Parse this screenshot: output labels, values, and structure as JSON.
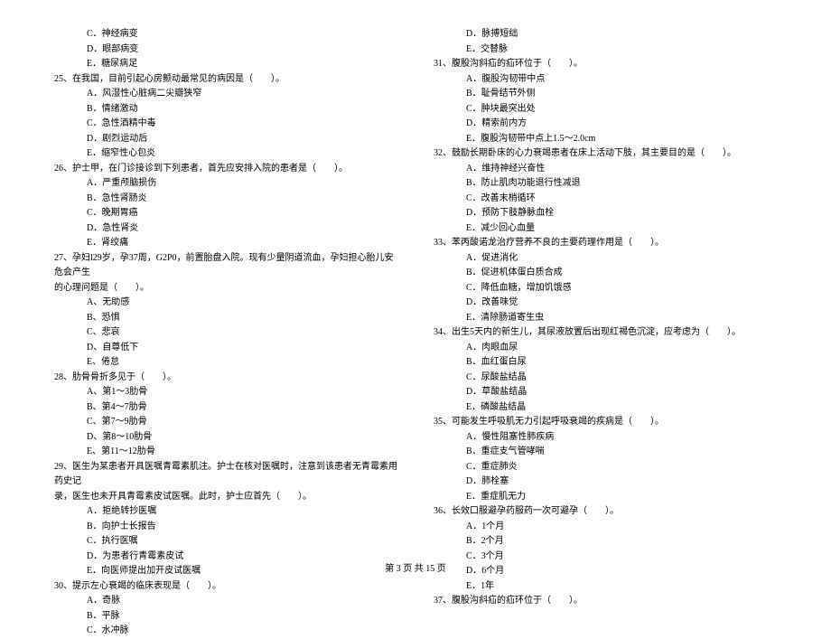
{
  "leftColumn": {
    "lines": [
      {
        "type": "option",
        "text": "C．神经病变"
      },
      {
        "type": "option",
        "text": "D．眼部病变"
      },
      {
        "type": "option",
        "text": "E．糖尿病足"
      },
      {
        "type": "question",
        "text": "25、在我国，目前引起心房颤动最常见的病因是（　　）。"
      },
      {
        "type": "option",
        "text": "A．风湿性心脏病二尖瓣狭窄"
      },
      {
        "type": "option",
        "text": "B．情绪激动"
      },
      {
        "type": "option",
        "text": "C．急性酒精中毒"
      },
      {
        "type": "option",
        "text": "D．剧烈运动后"
      },
      {
        "type": "option",
        "text": "E．缩窄性心包炎"
      },
      {
        "type": "question",
        "text": "26、护士甲，在门诊接诊到下列患者，首先应安排入院的患者是（　　）。"
      },
      {
        "type": "option",
        "text": "A．严重颅脑损伤"
      },
      {
        "type": "option",
        "text": "B．急性肾肠炎"
      },
      {
        "type": "option",
        "text": "C．晚期胃癌"
      },
      {
        "type": "option",
        "text": "D．急性肾炎"
      },
      {
        "type": "option",
        "text": "E．肾绞痛"
      },
      {
        "type": "question",
        "text": "27、孕妇l29岁，孕37周，G2P0，前置胎盘入院。现有少量阴道流血，孕妇担心胎儿安危会产生"
      },
      {
        "type": "continue",
        "text": "的心理问题是（　　）。"
      },
      {
        "type": "option",
        "text": "A、无助感"
      },
      {
        "type": "option",
        "text": "B、恐惧"
      },
      {
        "type": "option",
        "text": "C、悲哀"
      },
      {
        "type": "option",
        "text": "D、自尊低下"
      },
      {
        "type": "option",
        "text": "E、倦怠"
      },
      {
        "type": "question",
        "text": "28、肋骨骨折多见于（　　）。"
      },
      {
        "type": "option",
        "text": "A、第1～3肋骨"
      },
      {
        "type": "option",
        "text": "B、第4～7肋骨"
      },
      {
        "type": "option",
        "text": "C、第7～9肋骨"
      },
      {
        "type": "option",
        "text": "D、第8～10肋骨"
      },
      {
        "type": "option",
        "text": "E、第11～12肋骨"
      },
      {
        "type": "question",
        "text": "29、医生为某患者开具医嘱青霉素肌注。护士在核对医嘱时，注意到该患者无青霉素用药史记"
      },
      {
        "type": "continue",
        "text": "录，医生也未开具青霉素皮试医嘱。此时，护士应首先（　　）。"
      },
      {
        "type": "option",
        "text": "A．拒绝转抄医嘱"
      },
      {
        "type": "option",
        "text": "B．向护士长报告"
      },
      {
        "type": "option",
        "text": "C．执行医嘱"
      },
      {
        "type": "option",
        "text": "D．为患者行青霉素皮试"
      },
      {
        "type": "option",
        "text": "E．向医师提出加开皮试医嘱"
      },
      {
        "type": "question",
        "text": "30、提示左心衰竭的临床表现是（　　）。"
      },
      {
        "type": "option",
        "text": "A．奇脉"
      },
      {
        "type": "option",
        "text": "B．平脉"
      },
      {
        "type": "option",
        "text": "C．水冲脉"
      }
    ]
  },
  "rightColumn": {
    "lines": [
      {
        "type": "option",
        "text": "D．脉搏短绌"
      },
      {
        "type": "option",
        "text": "E．交替脉"
      },
      {
        "type": "question",
        "text": "31、腹股沟斜疝的疝环位于（　　）。"
      },
      {
        "type": "option",
        "text": "A．腹股沟韧带中点"
      },
      {
        "type": "option",
        "text": "B．耻骨结节外侧"
      },
      {
        "type": "option",
        "text": "C．肿块最突出处"
      },
      {
        "type": "option",
        "text": "D．精索前内方"
      },
      {
        "type": "option",
        "text": "E．腹股沟韧带中点上1.5～2.0cm"
      },
      {
        "type": "question",
        "text": "32、鼓励长期卧床的心力衰竭患者在床上活动下肢，其主要目的是（　　）。"
      },
      {
        "type": "option",
        "text": "A．维持神经兴奋性"
      },
      {
        "type": "option",
        "text": "B．防止肌肉功能退行性减退"
      },
      {
        "type": "option",
        "text": "C．改善末梢循环"
      },
      {
        "type": "option",
        "text": "D．预防下肢静脉血栓"
      },
      {
        "type": "option",
        "text": "E．减少回心血量"
      },
      {
        "type": "question",
        "text": "33、苯丙酸诺龙治疗营养不良的主要药理作用是（　　）。"
      },
      {
        "type": "option",
        "text": "A．促进消化"
      },
      {
        "type": "option",
        "text": "B．促进机体蛋白质合成"
      },
      {
        "type": "option",
        "text": "C．降低血糖，增加饥饿感"
      },
      {
        "type": "option",
        "text": "D．改善味觉"
      },
      {
        "type": "option",
        "text": "E．清除肠道寄生虫"
      },
      {
        "type": "question",
        "text": "34、出生5天内的新生儿，其尿液放置后出现红褐色沉淀，应考虑为（　　）。"
      },
      {
        "type": "option",
        "text": "A．肉眼血尿"
      },
      {
        "type": "option",
        "text": "B．血红蛋白尿"
      },
      {
        "type": "option",
        "text": "C．尿酸盐结晶"
      },
      {
        "type": "option",
        "text": "D．草酸盐结晶"
      },
      {
        "type": "option",
        "text": "E．磷酸盐结晶"
      },
      {
        "type": "question",
        "text": "35、可能发生呼吸肌无力引起呼吸衰竭的疾病是（　　）。"
      },
      {
        "type": "option",
        "text": "A．慢性阻塞性肺疾病"
      },
      {
        "type": "option",
        "text": "B．重症支气管哮喘"
      },
      {
        "type": "option",
        "text": "C．重症肺炎"
      },
      {
        "type": "option",
        "text": "D．肺栓塞"
      },
      {
        "type": "option",
        "text": "E．重症肌无力"
      },
      {
        "type": "question",
        "text": "36、长效口服避孕药服药一次可避孕（　　）。"
      },
      {
        "type": "option",
        "text": "A．1个月"
      },
      {
        "type": "option",
        "text": "B．2个月"
      },
      {
        "type": "option",
        "text": "C．3个月"
      },
      {
        "type": "option",
        "text": "D．6个月"
      },
      {
        "type": "option",
        "text": "E．1年"
      },
      {
        "type": "question",
        "text": "37、腹股沟斜疝的疝环位于（　　）。"
      }
    ]
  },
  "footer": {
    "text": "第 3 页 共 15 页"
  }
}
